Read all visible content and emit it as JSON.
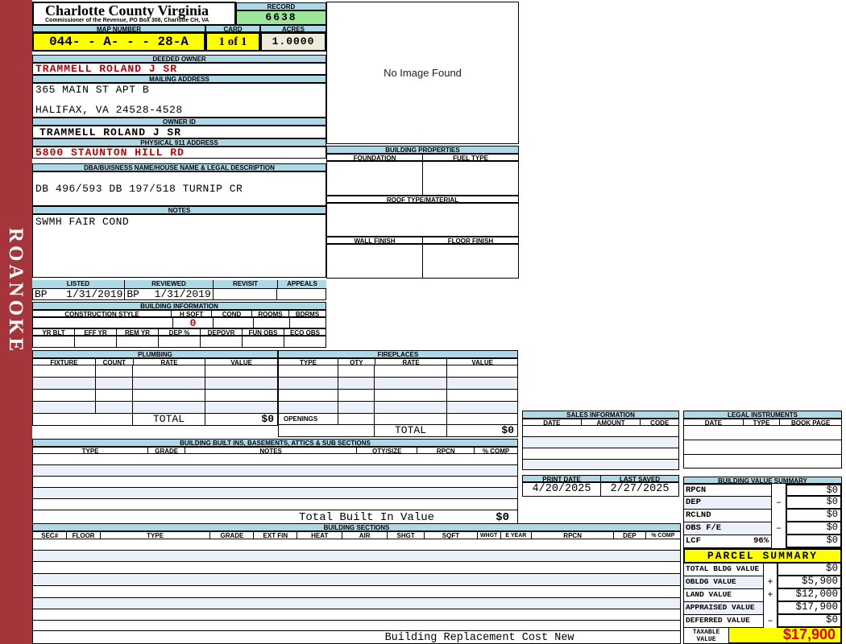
{
  "sidebar": {
    "vertical_text": "ROANOKE"
  },
  "header": {
    "title": "Charlotte County Virginia",
    "subtitle": "Commissioner of the Revenue, PO Box 308, Charlotte CH, VA",
    "record": {
      "label": "RECORD",
      "value": "6638"
    },
    "map": {
      "label": "MAP NUMBER",
      "value": "044- - A- - - 28-A"
    },
    "card": {
      "label": "CARD",
      "value": "1 of 1"
    },
    "acres": {
      "label": "ACRES",
      "value": "1.0000"
    }
  },
  "owner": {
    "deeded_owner_label": "DEEDED OWNER",
    "deeded_owner": "TRAMMELL ROLAND J SR",
    "mailing_label": "MAILING ADDRESS",
    "mailing_line1": "365 MAIN ST  APT B",
    "mailing_line2": "HALIFAX, VA 24528-4528",
    "owner_id_label": "OWNER ID",
    "owner_id": "TRAMMELL ROLAND J SR",
    "physical_label": "PHYSICAL 911 ADDRESS",
    "physical_address": "5800 STAUNTON HILL RD",
    "dba_label": "DBA/BUISNESS NAME/HOUSE NAME & LEGAL DESCRIPTION",
    "legal_description": "DB 496/593 DB 197/518 TURNIP CR",
    "notes_label": "NOTES",
    "notes": "SWMH FAIR COND"
  },
  "image_panel": {
    "placeholder": "No Image Found"
  },
  "building_properties": {
    "label": "BUILDING PROPERTIES",
    "foundation_label": "FOUNDATION",
    "fuel_type_label": "FUEL TYPE",
    "roof_label": "ROOF TYPE/MATERIAL",
    "wall_label": "WALL FINISH",
    "floor_label": "FLOOR FINISH"
  },
  "review": {
    "headers": [
      "LISTED",
      "REVIEWED",
      "REVISIT",
      "APPEALS"
    ],
    "listed_by": "BP",
    "listed_date": "1/31/2019",
    "reviewed_by": "BP",
    "reviewed_date": "1/31/2019",
    "revisit": "",
    "appeals": ""
  },
  "building_information": {
    "label": "BUILDING INFORMATION",
    "row1_headers": [
      "CONSTRUCTION STYLE",
      "H SQFT",
      "COND",
      "ROOMS",
      "BDRMS"
    ],
    "h_sqft_value": "0",
    "row2_headers": [
      "YR BLT",
      "EFF YR",
      "REM YR",
      "DEP %",
      "DEPOVR",
      "FUN OBS",
      "ECO OBS"
    ]
  },
  "plumbing": {
    "label": "PLUMBING",
    "headers": [
      "FIXTURE",
      "COUNT",
      "RATE",
      "VALUE"
    ],
    "total_label": "TOTAL",
    "total_value": "$0"
  },
  "fireplaces": {
    "label": "FIREPLACES",
    "headers": [
      "TYPE",
      "QTY",
      "RATE",
      "VALUE"
    ],
    "openings_label": "OPENINGS",
    "total_label": "TOTAL",
    "total_value": "$0"
  },
  "built_ins": {
    "label": "BUILDING BUILT INS, BASEMENTS, ATTICS & SUB SECTIONS",
    "headers": [
      "TYPE",
      "GRADE",
      "NOTES",
      "QTY/SIZE",
      "RPCN",
      "% COMP"
    ],
    "total_label": "Total Built In Value",
    "total_value": "$0"
  },
  "sales": {
    "label": "SALES INFORMATION",
    "headers": [
      "DATE",
      "AMOUNT",
      "CODE"
    ]
  },
  "legal_instruments": {
    "label": "LEGAL INSTRUMENTS",
    "headers": [
      "DATE",
      "TYPE",
      "BOOK PAGE"
    ]
  },
  "dates": {
    "print_date_label": "PRINT DATE",
    "print_date": "4/20/2025",
    "last_saved_label": "LAST SAVED",
    "last_saved": "2/27/2025"
  },
  "building_value_summary": {
    "label": "BUILDING VALUE SUMMARY",
    "rows": [
      {
        "label": "RPCN",
        "op": "",
        "value": "$0"
      },
      {
        "label": "DEP",
        "op": "–",
        "value": "$0"
      },
      {
        "label": "RCLND",
        "op": "",
        "value": "$0"
      },
      {
        "label": "OBS F/E",
        "op": "–",
        "value": "$0"
      },
      {
        "label": "LCF",
        "pct": "96%",
        "op": "",
        "value": "$0"
      }
    ]
  },
  "building_sections": {
    "label": "BUILDING SECTIONS",
    "headers": [
      "SEC#",
      "FLOOR",
      "TYPE",
      "GRADE",
      "EXT FIN",
      "HEAT",
      "AIR",
      "SHGT",
      "SQFT",
      "WHGT",
      "E YEAR",
      "RPCN",
      "DEP",
      "% COMP"
    ]
  },
  "footer": {
    "label": "Building Replacement Cost New"
  },
  "parcel_summary": {
    "label": "PARCEL SUMMARY",
    "rows": [
      {
        "label": "TOTAL BLDG VALUE",
        "op": "",
        "value": "$0"
      },
      {
        "label": "OBLDG VALUE",
        "op": "+",
        "value": "$5,900"
      },
      {
        "label": "LAND VALUE",
        "op": "+",
        "value": "$12,000"
      },
      {
        "label": "APPRAISED VALUE",
        "op": "",
        "value": "$17,900"
      },
      {
        "label": "DEFERRED VALUE",
        "op": "–",
        "value": "$0"
      }
    ],
    "taxable_label_line1": "TAXABLE",
    "taxable_label_line2": "VALUE",
    "taxable_value": "$17,900"
  },
  "colors": {
    "sidebar_red": "#A5343B",
    "header_blue": "#ADD8E6",
    "highlight_yellow": "#FFFF00",
    "record_green": "#9CE69C",
    "acres_cream": "#EFEBDB",
    "value_red": "#C00000"
  }
}
